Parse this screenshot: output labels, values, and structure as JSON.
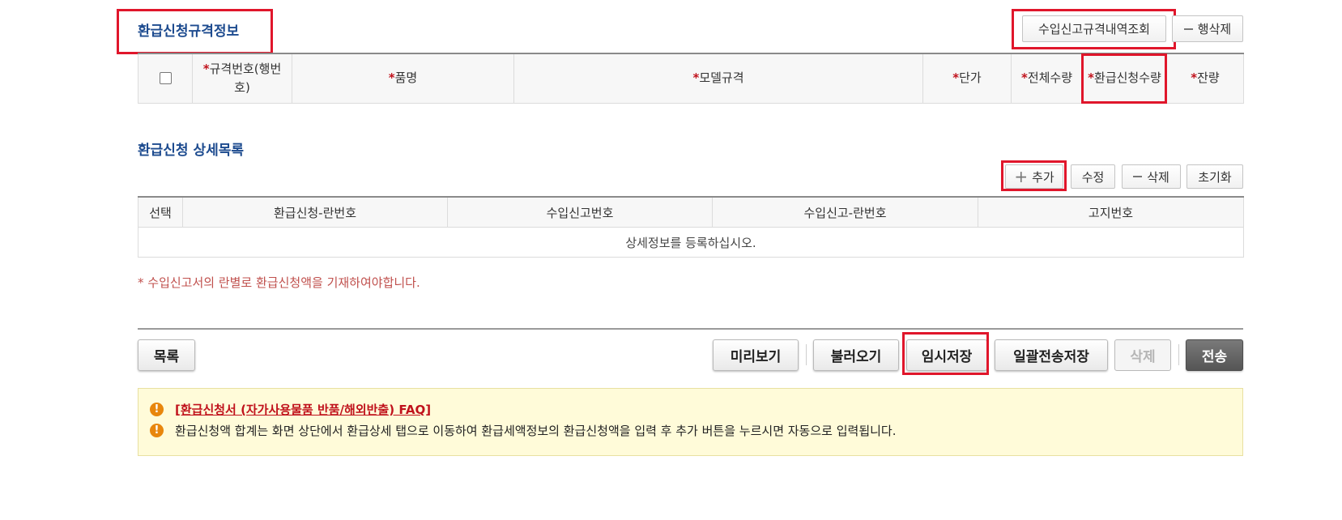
{
  "spec_section": {
    "title": "환급신청규격정보",
    "lookup_button": "수입신고규격내역조회",
    "delete_row_button": "행삭제",
    "columns": {
      "spec_no": "규격번호(행번호)",
      "item_name": "품명",
      "model_spec": "모델규격",
      "unit_price": "단가",
      "total_qty": "전체수량",
      "refund_qty": "환급신청수량",
      "remaining_qty": "잔량"
    },
    "required_mark": "*"
  },
  "detail_section": {
    "title": "환급신청 상세목록",
    "buttons": {
      "add": "추가",
      "edit": "수정",
      "delete": "삭제",
      "reset": "초기화"
    },
    "columns": {
      "select": "선택",
      "refund_line_no": "환급신청-란번호",
      "import_decl_no": "수입신고번호",
      "import_decl_line_no": "수입신고-란번호",
      "notice_no": "고지번호"
    },
    "empty_message": "상세정보를 등록하십시오.",
    "note": "* 수입신고서의 란별로 환급신청액을 기재하여야합니다."
  },
  "actions": {
    "list": "목록",
    "preview": "미리보기",
    "load": "불러오기",
    "temp_save": "임시저장",
    "batch_save": "일괄전송저장",
    "delete": "삭제",
    "send": "전송"
  },
  "info": {
    "faq_link": "[환급신청서 (자가사용물품 반품/해외반출) FAQ]",
    "message": "환급신청액 합계는 화면 상단에서 환급상세 탭으로 이동하여 환급세액정보의 환급신청액을 입력 후 추가 버튼을 누르시면 자동으로 입력됩니다."
  },
  "colors": {
    "title_blue": "#1d4b8f",
    "highlight_red": "#e0162b",
    "note_red": "#c0504d",
    "info_bg": "#fffbd9"
  }
}
